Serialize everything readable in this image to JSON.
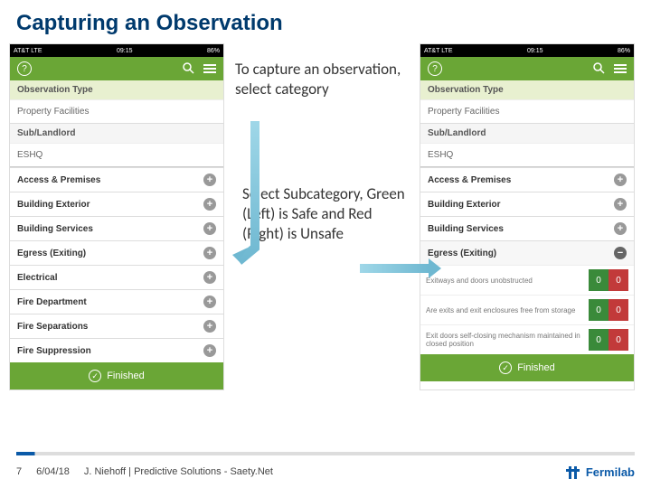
{
  "title": "Capturing an Observation",
  "status_bar": {
    "carrier": "AT&T  LTE",
    "time": "09:15",
    "battery": "86%"
  },
  "app_header": {
    "help": "?"
  },
  "section": {
    "obs_type": "Observation Type",
    "prop_fac": "Property Facilities",
    "sub_landlord": "Sub/Landlord",
    "eshq": "ESHQ"
  },
  "categories": {
    "c0": "Access & Premises",
    "c1": "Building Exterior",
    "c2": "Building Services",
    "c3": "Egress (Exiting)",
    "c4": "Electrical",
    "c5": "Fire Department",
    "c6": "Fire Separations",
    "c7": "Fire Suppression"
  },
  "sub_items": {
    "s0": "Exitways and doors unobstructed",
    "s1": "Are exits and exit enclosures free from storage",
    "s2": "Exit doors self-closing mechanism maintained in closed position"
  },
  "counts": {
    "zero": "0"
  },
  "finished": "Finished",
  "instructions": {
    "i1": "To capture an observation, select category",
    "i2": "Select Subcategory, Green (Left) is Safe and Red (Right) is Unsafe"
  },
  "footer": {
    "page": "7",
    "date": "6/04/18",
    "credit": "J. Niehoff | Predictive Solutions - Saety.Net",
    "logo": "Fermilab"
  }
}
